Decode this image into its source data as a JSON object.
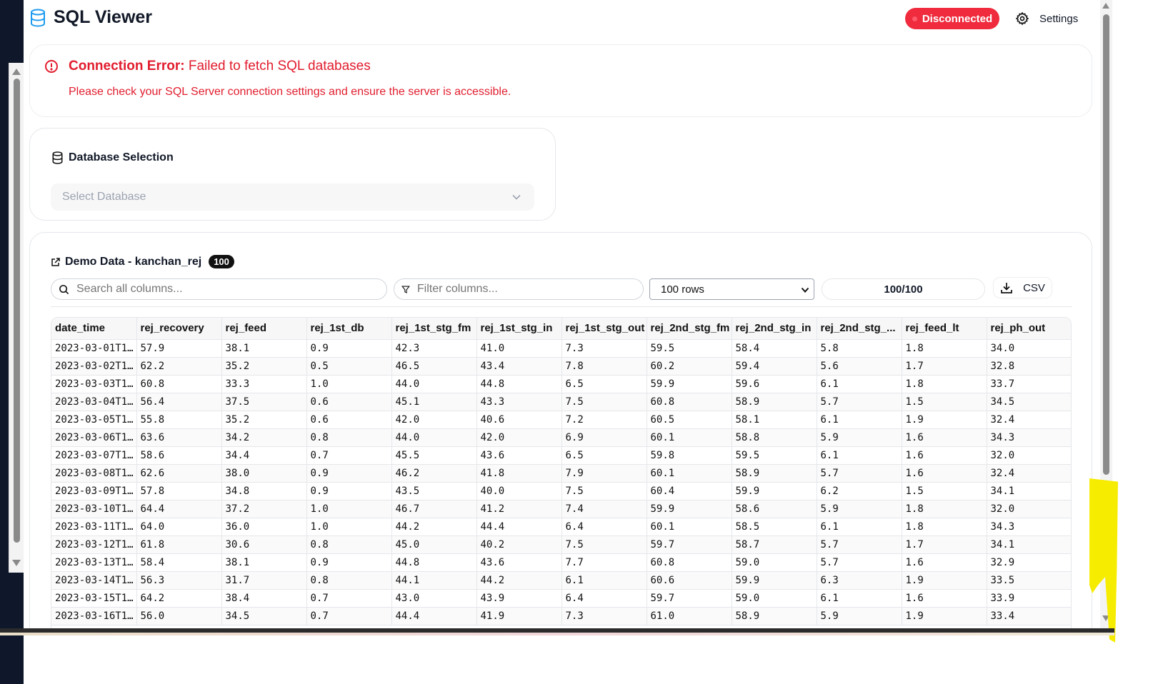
{
  "app": {
    "title": "SQL Viewer"
  },
  "header": {
    "status": "Disconnected",
    "status_color": "#ef2b3d",
    "settings_label": "Settings"
  },
  "error": {
    "title": "Connection Error:",
    "summary": "Failed to fetch SQL databases",
    "message": "Please check your SQL Server connection settings and ensure the server is accessible.",
    "color": "#e11d2e"
  },
  "database": {
    "title": "Database Selection",
    "placeholder": "Select Database"
  },
  "data": {
    "title": "Demo Data - kanchan_rej",
    "count_badge": "100",
    "search_placeholder": "Search all columns...",
    "filter_placeholder": "Filter columns...",
    "rows_selected": "100 rows",
    "row_count": "100/100",
    "csv_label": "CSV",
    "columns": [
      "date_time",
      "rej_recovery",
      "rej_feed",
      "rej_1st_db",
      "rej_1st_stg_fm",
      "rej_1st_stg_in",
      "rej_1st_stg_out",
      "rej_2nd_stg_fm",
      "rej_2nd_stg_in",
      "rej_2nd_stg_...",
      "rej_feed_lt",
      "rej_ph_out"
    ],
    "rows": [
      [
        "2023-03-01T1…",
        "57.9",
        "38.1",
        "0.9",
        "42.3",
        "41.0",
        "7.3",
        "59.5",
        "58.4",
        "5.8",
        "1.8",
        "34.0"
      ],
      [
        "2023-03-02T1…",
        "62.2",
        "35.2",
        "0.5",
        "46.5",
        "43.4",
        "7.8",
        "60.2",
        "59.4",
        "5.6",
        "1.7",
        "32.8"
      ],
      [
        "2023-03-03T1…",
        "60.8",
        "33.3",
        "1.0",
        "44.0",
        "44.8",
        "6.5",
        "59.9",
        "59.6",
        "6.1",
        "1.8",
        "33.7"
      ],
      [
        "2023-03-04T1…",
        "56.4",
        "37.5",
        "0.6",
        "45.1",
        "43.3",
        "7.5",
        "60.8",
        "58.9",
        "5.7",
        "1.5",
        "34.5"
      ],
      [
        "2023-03-05T1…",
        "55.8",
        "35.2",
        "0.6",
        "42.0",
        "40.6",
        "7.2",
        "60.5",
        "58.1",
        "6.1",
        "1.9",
        "32.4"
      ],
      [
        "2023-03-06T1…",
        "63.6",
        "34.2",
        "0.8",
        "44.0",
        "42.0",
        "6.9",
        "60.1",
        "58.8",
        "5.9",
        "1.6",
        "34.3"
      ],
      [
        "2023-03-07T1…",
        "58.6",
        "34.4",
        "0.7",
        "45.5",
        "43.6",
        "6.5",
        "59.8",
        "59.5",
        "6.1",
        "1.6",
        "32.0"
      ],
      [
        "2023-03-08T1…",
        "62.6",
        "38.0",
        "0.9",
        "46.2",
        "41.8",
        "7.9",
        "60.1",
        "58.9",
        "5.7",
        "1.6",
        "32.4"
      ],
      [
        "2023-03-09T1…",
        "57.8",
        "34.8",
        "0.9",
        "43.5",
        "40.0",
        "7.5",
        "60.4",
        "59.9",
        "6.2",
        "1.5",
        "34.1"
      ],
      [
        "2023-03-10T1…",
        "64.4",
        "37.2",
        "1.0",
        "46.7",
        "41.2",
        "7.4",
        "59.9",
        "58.6",
        "5.9",
        "1.8",
        "32.0"
      ],
      [
        "2023-03-11T1…",
        "64.0",
        "36.0",
        "1.0",
        "44.2",
        "44.4",
        "6.4",
        "60.1",
        "58.5",
        "6.1",
        "1.8",
        "34.3"
      ],
      [
        "2023-03-12T1…",
        "61.8",
        "30.6",
        "0.8",
        "45.0",
        "40.2",
        "7.5",
        "59.7",
        "58.7",
        "5.7",
        "1.7",
        "34.1"
      ],
      [
        "2023-03-13T1…",
        "58.4",
        "38.1",
        "0.9",
        "44.8",
        "43.6",
        "7.7",
        "60.8",
        "59.0",
        "5.7",
        "1.6",
        "32.9"
      ],
      [
        "2023-03-14T1…",
        "56.3",
        "31.7",
        "0.8",
        "44.1",
        "44.2",
        "6.1",
        "60.6",
        "59.9",
        "6.3",
        "1.9",
        "33.5"
      ],
      [
        "2023-03-15T1…",
        "64.2",
        "38.4",
        "0.7",
        "43.0",
        "43.9",
        "6.4",
        "59.7",
        "59.0",
        "6.1",
        "1.6",
        "33.9"
      ],
      [
        "2023-03-16T1…",
        "56.0",
        "34.5",
        "0.7",
        "44.4",
        "41.9",
        "7.3",
        "61.0",
        "58.9",
        "5.9",
        "1.9",
        "33.4"
      ]
    ]
  }
}
